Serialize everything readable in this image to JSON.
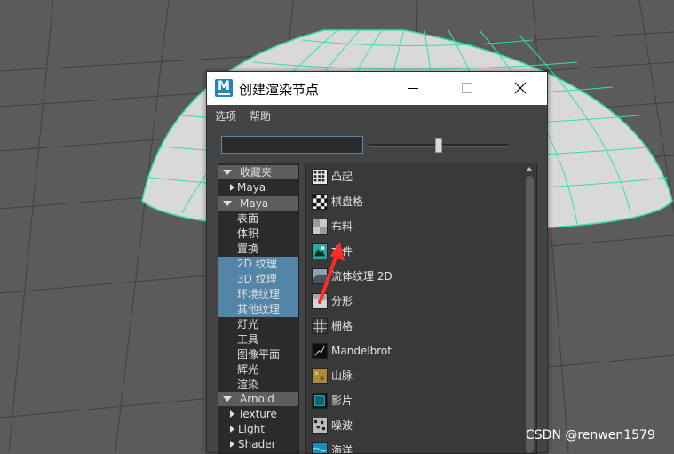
{
  "window": {
    "title": "创建渲染节点",
    "logo_letter": "M"
  },
  "menu": [
    {
      "label": "选项"
    },
    {
      "label": "帮助"
    }
  ],
  "search": {
    "value": ""
  },
  "zoom_slider": {
    "value_fraction": 0.5
  },
  "colors": {
    "selected_bg": "#5285a6",
    "sphere_wire": "#35e0a6",
    "annotation_arrow": "#ff2a2a"
  },
  "tree": {
    "favorites": {
      "label": "收藏夹",
      "children": [
        {
          "label": "Maya"
        }
      ]
    },
    "maya": {
      "label": "Maya",
      "children": [
        {
          "label": "表面",
          "selected": false
        },
        {
          "label": "体积",
          "selected": false
        },
        {
          "label": "置换",
          "selected": false
        },
        {
          "label": "2D 纹理",
          "selected": true
        },
        {
          "label": "3D 纹理",
          "selected": true
        },
        {
          "label": "环境纹理",
          "selected": true
        },
        {
          "label": "其他纹理",
          "selected": true
        },
        {
          "label": "灯光",
          "selected": false
        },
        {
          "label": "工具",
          "selected": false
        },
        {
          "label": "图像平面",
          "selected": false
        },
        {
          "label": "辉光",
          "selected": false
        },
        {
          "label": "渲染",
          "selected": false
        }
      ]
    },
    "arnold": {
      "label": "Arnold",
      "children": [
        {
          "label": "Texture"
        },
        {
          "label": "Light"
        },
        {
          "label": "Shader"
        }
      ]
    }
  },
  "nodes": [
    {
      "label": "凸起",
      "icon": "bump-icon"
    },
    {
      "label": "棋盘格",
      "icon": "checker-icon"
    },
    {
      "label": "布料",
      "icon": "cloth-icon"
    },
    {
      "label": "文件",
      "icon": "file-icon"
    },
    {
      "label": "流体纹理 2D",
      "icon": "fluid-texture-icon"
    },
    {
      "label": "分形",
      "icon": "fractal-icon"
    },
    {
      "label": "栅格",
      "icon": "grid-icon"
    },
    {
      "label": "Mandelbrot",
      "icon": "mandelbrot-icon"
    },
    {
      "label": "山脉",
      "icon": "mountain-icon"
    },
    {
      "label": "影片",
      "icon": "movie-icon"
    },
    {
      "label": "噪波",
      "icon": "noise-icon"
    },
    {
      "label": "海洋",
      "icon": "ocean-icon"
    }
  ],
  "watermark": "CSDN @renwen1579"
}
